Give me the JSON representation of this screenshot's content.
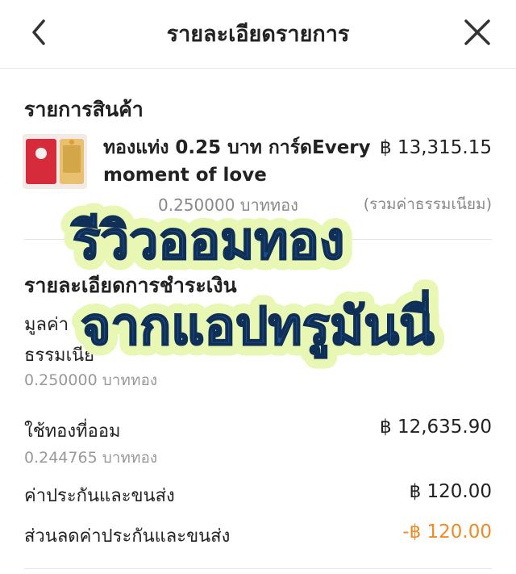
{
  "header": {
    "title": "รายละเอียดรายการ",
    "back_icon": "chevron-left-icon",
    "close_icon": "close-icon"
  },
  "product_section": {
    "title": "รายการสินค้า",
    "product_name": "ทองแท่ง 0.25 บาท การ์ดEvery moment of love",
    "price": "฿ 13,315.15",
    "weight": "0.250000 บาททอง",
    "fee_note": "(รวมค่าธรรมเนียม)"
  },
  "payment_section": {
    "title": "รายละเอียดการชำระเงิน",
    "rows": [
      {
        "label": "มูลค่า",
        "label2": "ธรรมเนีย",
        "sub": "0.250000 บาททอง",
        "value": ""
      },
      {
        "label": "ใช้ทองที่ออม",
        "sub": "0.244765 บาททอง",
        "value": "฿ 12,635.90"
      },
      {
        "label": "ค่าประกันและขนส่ง",
        "value": "฿ 120.00"
      },
      {
        "label": "ส่วนลดค่าประกันและขนส่ง",
        "value": "-฿ 120.00"
      }
    ]
  },
  "overlay": {
    "line1": "รีวิวออมทอง",
    "line2": "จากแอปทรูมันนี่"
  },
  "colors": {
    "accent_orange": "#f08a24",
    "banner_text": "#1e4f8c",
    "banner_fill": "#e9f7b5"
  }
}
